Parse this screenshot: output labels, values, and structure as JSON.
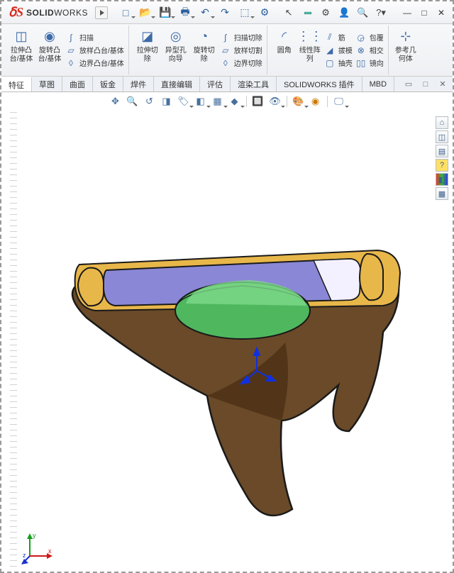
{
  "app": {
    "brand_prefix": "S",
    "brand": "SOLID",
    "brand2": "WORKS"
  },
  "qat": {
    "new": "□",
    "open": "📂",
    "save": "💾",
    "print": "🖶",
    "undo": "↶",
    "redo": "↷",
    "select": "⬚",
    "options": "⚙"
  },
  "title_right": {
    "cursor": "↖",
    "lights": "●●●",
    "settings": "⚙",
    "user": "👤",
    "search": "🔍",
    "help": "?"
  },
  "win": {
    "min": "—",
    "max": "□",
    "close": "✕"
  },
  "ribbon": {
    "extrude": "拉伸凸\n台/基体",
    "revolve": "旋转凸\n台/基体",
    "sweep": "扫描",
    "loft": "放样凸台/基体",
    "boundary": "边界凸台/基体",
    "cut_extrude": "拉伸切\n除",
    "hole_wizard": "异型孔\n向导",
    "cut_revolve": "旋转切\n除",
    "cut_sweep": "扫描切除",
    "cut_loft": "放样切割",
    "cut_boundary": "边界切除",
    "fillet": "圆角",
    "pattern": "线性阵\n列",
    "rib": "筋",
    "draft": "拔模",
    "shell": "抽壳",
    "wrap": "包覆",
    "intersect": "相交",
    "mirror": "镜向",
    "refgeom": "参考几\n何体"
  },
  "tabs": {
    "features": "特征",
    "sketch": "草图",
    "surfaces": "曲面",
    "sheetmetal": "钣金",
    "weldments": "焊件",
    "direct": "直接编辑",
    "evaluate": "评估",
    "render": "渲染工具",
    "plugins": "SOLIDWORKS 插件",
    "mbd": "MBD"
  },
  "right_tb": {
    "home": "⌂",
    "iso": "◫",
    "layers": "▤",
    "help": "?",
    "rgb": "◧",
    "grid": "▦"
  },
  "triad": {
    "x": "x",
    "y": "y",
    "z": "z"
  }
}
